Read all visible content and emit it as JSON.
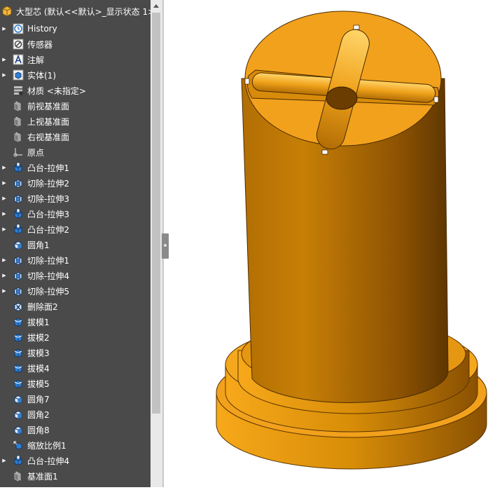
{
  "tree": {
    "root_label": "大型芯 (默认<<默认>_显示状态 1>)",
    "items": [
      {
        "label": "History",
        "icon": "history-icon",
        "expandable": true
      },
      {
        "label": "传感器",
        "icon": "sensor-icon",
        "expandable": false
      },
      {
        "label": "注解",
        "icon": "annotation-icon",
        "expandable": true
      },
      {
        "label": "实体(1)",
        "icon": "solid-bodies-icon",
        "expandable": true
      },
      {
        "label": "材质 <未指定>",
        "icon": "material-icon",
        "expandable": false
      },
      {
        "label": "前视基准面",
        "icon": "plane-icon",
        "expandable": false
      },
      {
        "label": "上视基准面",
        "icon": "plane-icon",
        "expandable": false
      },
      {
        "label": "右视基准面",
        "icon": "plane-icon",
        "expandable": false
      },
      {
        "label": "原点",
        "icon": "origin-icon",
        "expandable": false
      },
      {
        "label": "凸台-拉伸1",
        "icon": "boss-extrude-icon",
        "expandable": true
      },
      {
        "label": "切除-拉伸2",
        "icon": "cut-extrude-icon",
        "expandable": true
      },
      {
        "label": "切除-拉伸3",
        "icon": "cut-extrude-icon",
        "expandable": true
      },
      {
        "label": "凸台-拉伸3",
        "icon": "boss-extrude-icon",
        "expandable": true
      },
      {
        "label": "凸台-拉伸2",
        "icon": "boss-extrude-icon",
        "expandable": true
      },
      {
        "label": "圆角1",
        "icon": "fillet-icon",
        "expandable": false
      },
      {
        "label": "切除-拉伸1",
        "icon": "cut-extrude-icon",
        "expandable": true
      },
      {
        "label": "切除-拉伸4",
        "icon": "cut-extrude-icon",
        "expandable": true
      },
      {
        "label": "切除-拉伸5",
        "icon": "cut-extrude-icon",
        "expandable": true
      },
      {
        "label": "删除面2",
        "icon": "delete-face-icon",
        "expandable": false
      },
      {
        "label": "拔模1",
        "icon": "draft-icon",
        "expandable": false
      },
      {
        "label": "拔模2",
        "icon": "draft-icon",
        "expandable": false
      },
      {
        "label": "拔模3",
        "icon": "draft-icon",
        "expandable": false
      },
      {
        "label": "拔模4",
        "icon": "draft-icon",
        "expandable": false
      },
      {
        "label": "拔模5",
        "icon": "draft-icon",
        "expandable": false
      },
      {
        "label": "圆角7",
        "icon": "fillet-icon",
        "expandable": false
      },
      {
        "label": "圆角2",
        "icon": "fillet-icon",
        "expandable": false
      },
      {
        "label": "圆角8",
        "icon": "fillet-icon",
        "expandable": false
      },
      {
        "label": "缩放比例1",
        "icon": "scale-icon",
        "expandable": false
      },
      {
        "label": "凸台-拉伸4",
        "icon": "boss-extrude-icon",
        "expandable": true
      },
      {
        "label": "基准面1",
        "icon": "plane-icon",
        "expandable": false
      }
    ]
  },
  "colors": {
    "panel": "#4a4a4a",
    "model_main": "#d08a08",
    "model_top": "#f2a11c",
    "icon_blue": "#2f7fd4"
  }
}
